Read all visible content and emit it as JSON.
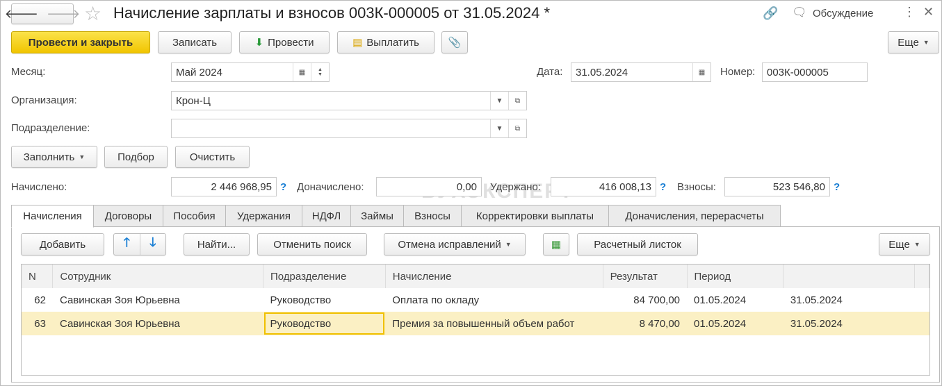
{
  "title": "Начисление зарплаты и взносов 003К-000005 от 31.05.2024 *",
  "header": {
    "discussion": "Обсуждение"
  },
  "toolbar": {
    "post_close": "Провести и закрыть",
    "save": "Записать",
    "post": "Провести",
    "pay": "Выплатить",
    "more": "Еще"
  },
  "form": {
    "month_label": "Месяц:",
    "month": "Май 2024",
    "date_label": "Дата:",
    "date": "31.05.2024",
    "number_label": "Номер:",
    "number": "003К-000005",
    "org_label": "Организация:",
    "org": "Крон-Ц",
    "dept_label": "Подразделение:",
    "dept": "",
    "fill": "Заполнить",
    "pick": "Подбор",
    "clear": "Очистить",
    "accrued_label": "Начислено:",
    "accrued": "2 446 968,95",
    "extra_label": "Доначислено:",
    "extra": "0,00",
    "withheld_label": "Удержано:",
    "withheld": "416 008,13",
    "contrib_label": "Взносы:",
    "contrib": "523 546,80",
    "q": "?"
  },
  "watermark": "БУХЭКСПЕРТ",
  "tabs": [
    "Начисления",
    "Договоры",
    "Пособия",
    "Удержания",
    "НДФЛ",
    "Займы",
    "Взносы",
    "Корректировки выплаты",
    "Доначисления, перерасчеты"
  ],
  "tabletoolbar": {
    "add": "Добавить",
    "find": "Найти...",
    "cancel_find": "Отменить поиск",
    "undo": "Отмена исправлений",
    "payslip": "Расчетный листок",
    "more": "Еще"
  },
  "table": {
    "columns": [
      "N",
      "Сотрудник",
      "Подразделение",
      "Начисление",
      "Результат",
      "Период",
      ""
    ],
    "rows": [
      {
        "n": "62",
        "emp": "Савинская Зоя Юрьевна",
        "dept": "Руководство",
        "acc": "Оплата по окладу",
        "res": "84 700,00",
        "from": "01.05.2024",
        "to": "31.05.2024"
      },
      {
        "n": "63",
        "emp": "Савинская Зоя Юрьевна",
        "dept": "Руководство",
        "acc": "Премия за повышенный объем работ",
        "res": "8 470,00",
        "from": "01.05.2024",
        "to": "31.05.2024"
      }
    ]
  }
}
